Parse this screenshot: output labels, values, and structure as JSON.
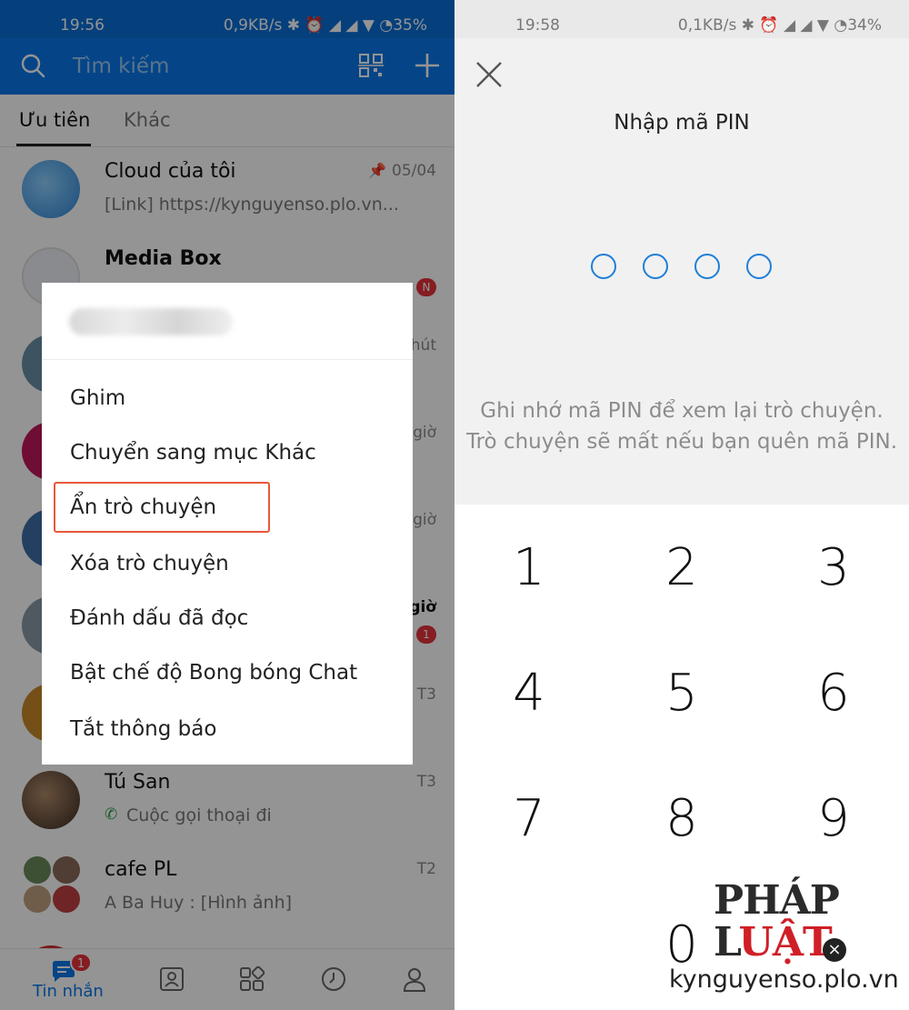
{
  "left_screen": {
    "status_bar": {
      "time": "19:56",
      "stats": "0,9KB/s ✱ ⏰ ◢ ◢ ▼ ◔35%"
    },
    "search": {
      "placeholder": "Tìm kiếm"
    },
    "tabs": [
      {
        "label": "Ưu tiên",
        "active": true
      },
      {
        "label": "Khác",
        "active": false
      }
    ],
    "chats": [
      {
        "name": "Cloud của tôi",
        "preview": "[Link] https://kynguyenso.plo.vn...",
        "time": "05/04",
        "pinned": true,
        "avatar_color": "#4a9fe0"
      },
      {
        "name": "Media Box",
        "preview": "",
        "time": "",
        "badge": "N",
        "avatar_color": "#e8e8f0"
      },
      {
        "name": "",
        "preview": "",
        "time": "phút",
        "avatar_color": "#7aa0b8"
      },
      {
        "name": "",
        "preview": "",
        "time": "giờ",
        "avatar_color": "#c2185b"
      },
      {
        "name": "",
        "preview": "",
        "time": "giờ",
        "avatar_color": "#3d6ea8"
      },
      {
        "name": "",
        "preview": "",
        "time": "giờ",
        "badge": "1",
        "avatar_color": "#8a9aa6"
      },
      {
        "name": "",
        "preview": "",
        "time": "T3",
        "avatar_color": "#c98a2a"
      },
      {
        "name": "Tú San",
        "preview": "Cuộc gọi thoại đi",
        "time": "T3",
        "avatar_color": "#5a4a3a"
      },
      {
        "name": "cafe PL",
        "preview": "A Ba Huy : [Hình ảnh]",
        "time": "T2",
        "avatar_color": "#6a8a5a"
      }
    ],
    "context_menu": {
      "items": [
        "Ghim",
        "Chuyển sang mục Khác",
        "Ẩn trò chuyện",
        "Xóa trò chuyện",
        "Đánh dấu đã đọc",
        "Bật chế độ Bong bóng Chat",
        "Tắt thông báo"
      ],
      "highlighted": "Ẩn trò chuyện"
    },
    "bottom_nav": {
      "messages_label": "Tin nhắn",
      "messages_badge": "1"
    }
  },
  "right_screen": {
    "status_bar": {
      "time": "19:58",
      "stats": "0,1KB/s ✱ ⏰ ◢ ◢ ▼ ◔34%"
    },
    "title": "Nhập mã PIN",
    "hint": "Ghi nhớ mã PIN để xem lại trò chuyện. Trò chuyện sẽ mất nếu bạn quên mã PIN.",
    "keys": [
      "1",
      "2",
      "3",
      "4",
      "5",
      "6",
      "7",
      "8",
      "9",
      "0"
    ],
    "pin_dots": 4
  },
  "watermark": {
    "brand_left": "PHÁP L",
    "brand_right": "UẬT",
    "domain": "kynguyenso.plo.vn"
  },
  "colors": {
    "zalo_blue": "#0a78e8",
    "pin_dot": "#1f7fd8",
    "highlight_border": "#e8573a",
    "badge_red": "#e5333b"
  }
}
